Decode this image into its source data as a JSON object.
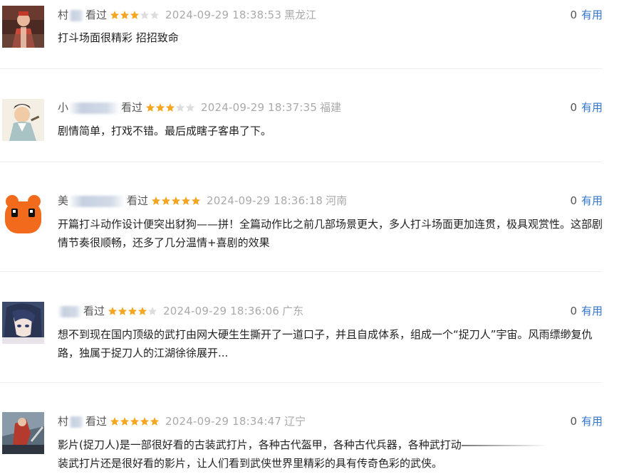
{
  "reviews": [
    {
      "username": "村",
      "watched_label": "看过",
      "rating": 3,
      "time": "2024-09-29 18:38:53",
      "location": "黑龙江",
      "useful_count": "0",
      "useful_label": "有用",
      "content": "打斗场面很精彩 招招致命",
      "avatar": "person-in-costume-avatar"
    },
    {
      "username": "小",
      "watched_label": "看过",
      "rating": 3,
      "time": "2024-09-29 18:37:35",
      "location": "福建",
      "useful_count": "0",
      "useful_label": "有用",
      "content": "剧情简单，打戏不错。最后成瞎子客串了下。",
      "avatar": "cartoon-scholar-avatar"
    },
    {
      "username": "美",
      "watched_label": "看过",
      "rating": 5,
      "time": "2024-09-29 18:36:18",
      "location": "河南",
      "useful_count": "0",
      "useful_label": "有用",
      "content": "开篇打斗动作设计便突出豺狗——拼！全篇动作比之前几部场景更大，多人打斗场面更加连贯，极具观赏性。这部剧情节奏很顺畅，还多了几分温情+喜剧的效果",
      "avatar": "orange-bear-avatar"
    },
    {
      "username": "",
      "watched_label": "看过",
      "rating": 4,
      "time": "2024-09-29 18:36:06",
      "location": "广东",
      "useful_count": "0",
      "useful_label": "有用",
      "content": "想不到现在国内顶级的武打由网大硬生生撕开了一道口子，并且自成体系，组成一个“捉刀人”宇宙。风雨缥缈复仇路，独属于捉刀人的江湖徐徐展开...",
      "avatar": "anime-girl-avatar"
    },
    {
      "username": "村",
      "watched_label": "看过",
      "rating": 5,
      "time": "2024-09-29 18:34:47",
      "location": "辽宁",
      "useful_count": "0",
      "useful_label": "有用",
      "content_part1": "影片(捉刀人)是一部很好看的古装武打片，各种古代盔甲，各种古代兵器，各种武打动",
      "content_part2": "装武打片还是很好看的影片，让人们看到武侠世界里精彩的具有传奇色彩的武侠。",
      "avatar": "warrior-poster-avatar"
    }
  ],
  "colors": {
    "star_filled": "#f5a623",
    "star_empty": "#dddddd",
    "useful_link": "#3377cc",
    "meta_text": "#aaaaaa"
  }
}
